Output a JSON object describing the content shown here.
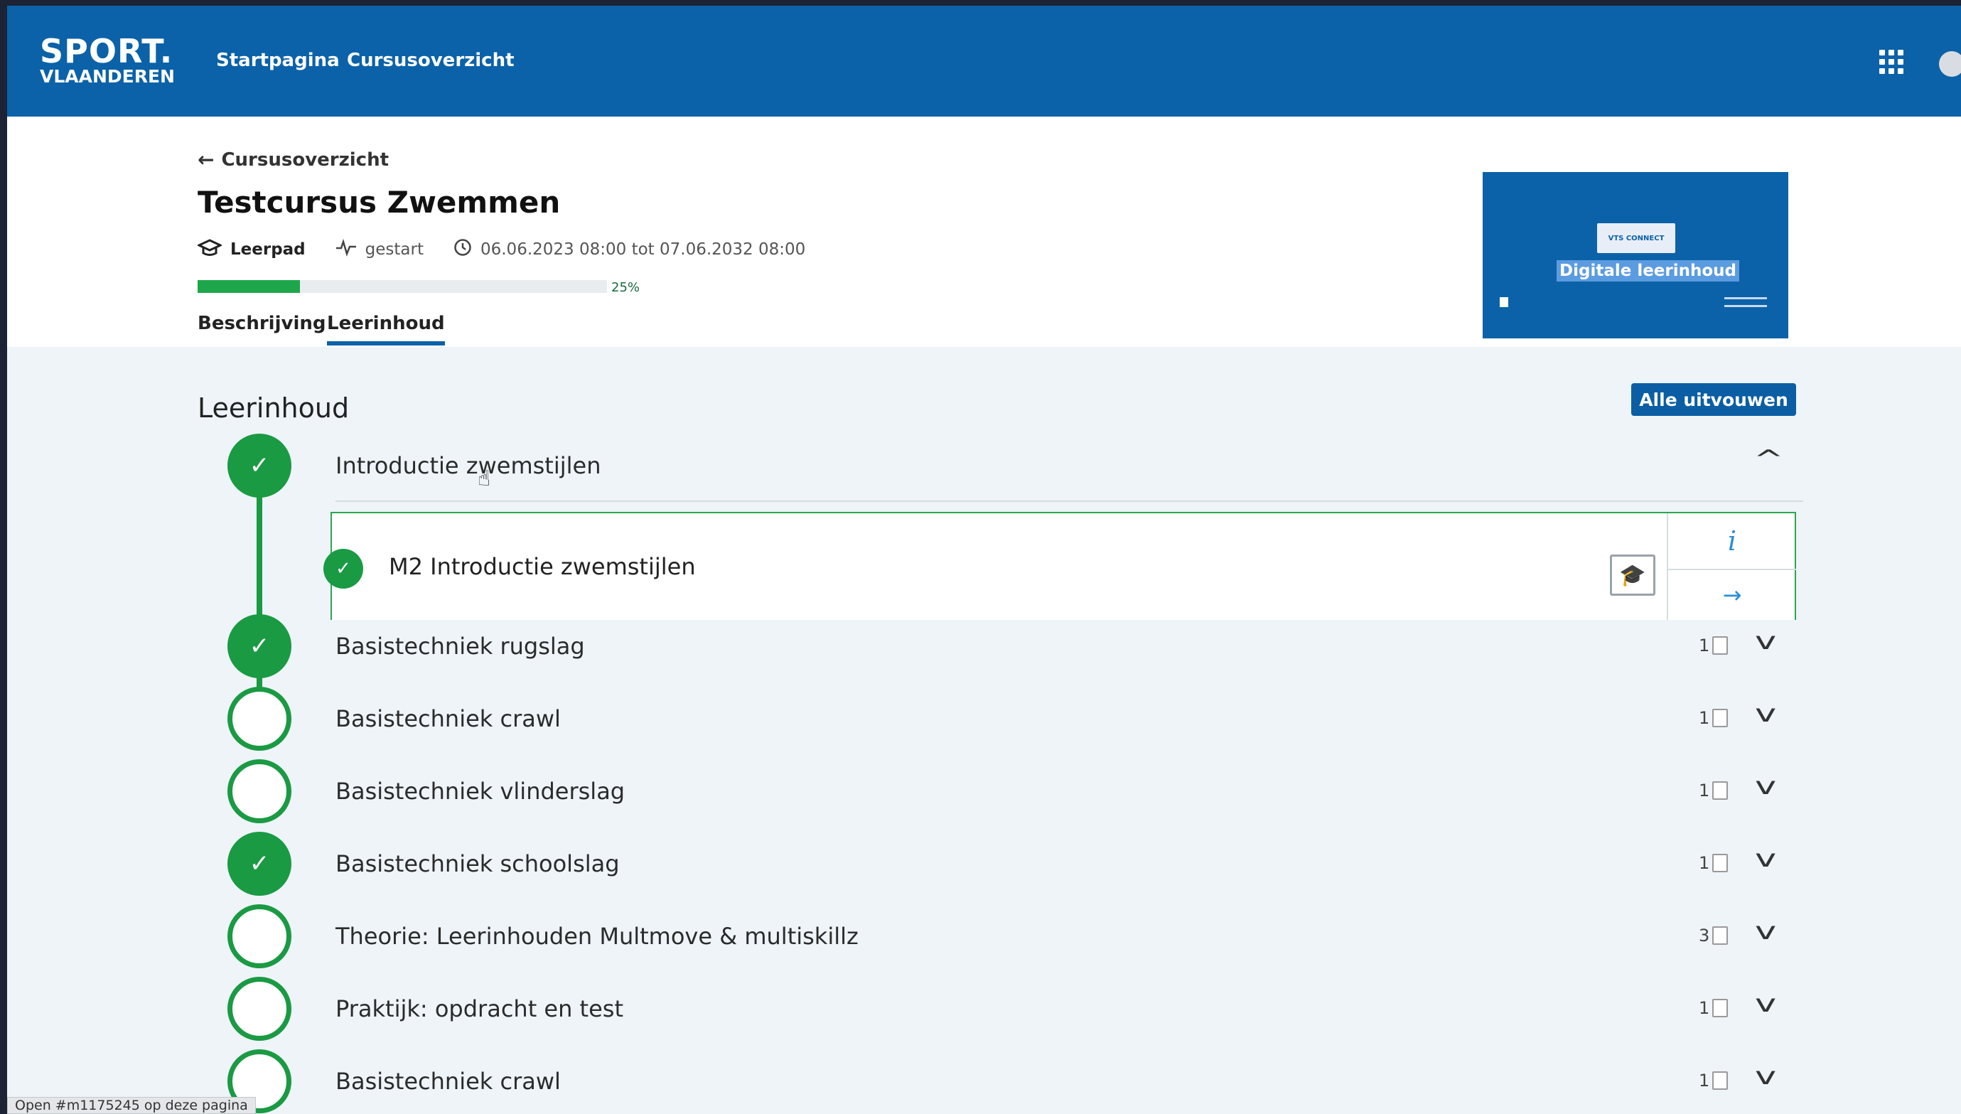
{
  "header": {
    "logo_line1": "SPORT.",
    "logo_line2": "VLAANDEREN",
    "nav": [
      "Startpagina",
      "Cursusoverzicht"
    ],
    "brand_color": "#0b62a8"
  },
  "course": {
    "back_label": "Cursusoverzicht",
    "title": "Testcursus Zwemmen",
    "type": "Leerpad",
    "status": "gestart",
    "period": "06.06.2023 08:00 tot 07.06.2032 08:00",
    "progress_percent": 25,
    "progress_label": "25%",
    "tabs": [
      "Beschrijving",
      "Leerinhoud"
    ],
    "active_tab": "Leerinhoud",
    "thumbnail": {
      "logo_text": "VTS CONNECT",
      "label": "Digitale leerinhoud"
    }
  },
  "content": {
    "section_title": "Leerinhoud",
    "expand_all_label": "Alle uitvouwen",
    "modules": [
      {
        "label": "Introductie zwemstijlen",
        "done": true,
        "expanded": true
      },
      {
        "label": "Basistechniek rugslag",
        "done": true,
        "count": "1"
      },
      {
        "label": "Basistechniek crawl",
        "done": false,
        "count": "1"
      },
      {
        "label": "Basistechniek vlinderslag",
        "done": false,
        "count": "1"
      },
      {
        "label": "Basistechniek schoolslag",
        "done": true,
        "count": "1"
      },
      {
        "label": "Theorie: Leerinhouden Multmove & multiskillz",
        "done": false,
        "count": "3"
      },
      {
        "label": "Praktijk: opdracht en test",
        "done": false,
        "count": "1"
      },
      {
        "label": "Basistechniek crawl",
        "done": false,
        "count": "1"
      }
    ],
    "submodule": {
      "label": "M2 Introductie zwemstijlen",
      "info_icon": "info-icon",
      "go_icon": "arrow-right-icon"
    }
  },
  "status_bar": "Open #m1175245 op deze pagina"
}
